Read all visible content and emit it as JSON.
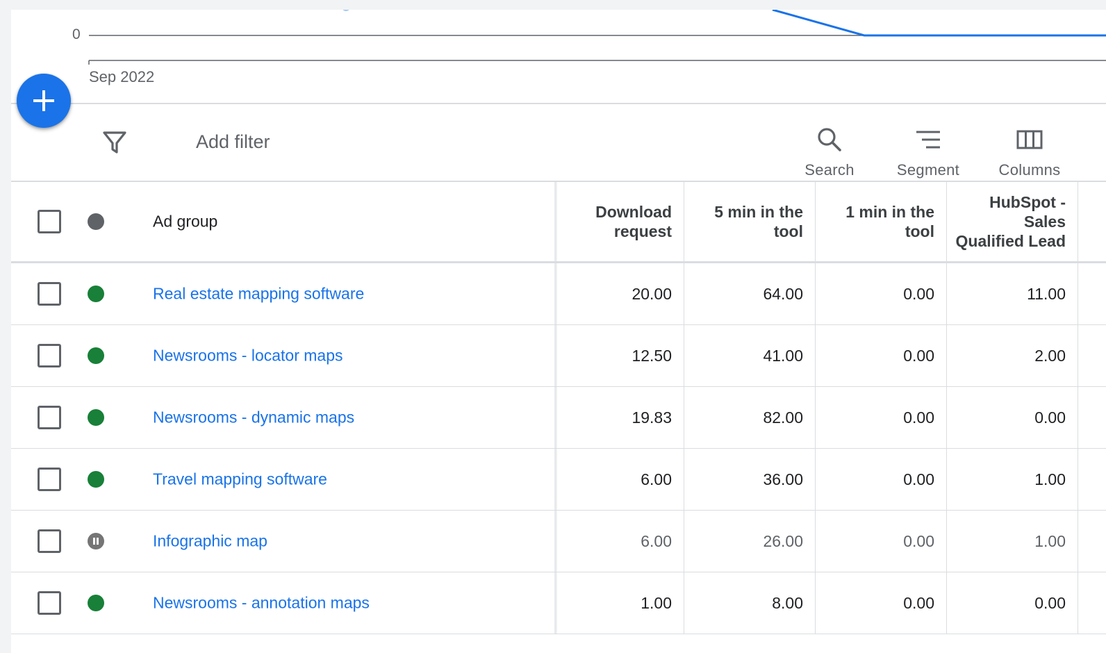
{
  "chart": {
    "y_zero_label": "0",
    "x_start_label": "Sep 2022",
    "line_color": "#1a73e8"
  },
  "fab": {
    "icon": "plus-icon",
    "color": "#1a73e8"
  },
  "toolbar": {
    "filter_icon": "filter-funnel-icon",
    "add_filter_label": "Add filter",
    "search_label": "Search",
    "segment_label": "Segment",
    "columns_label": "Columns"
  },
  "table": {
    "headers": {
      "ad_group": "Ad group",
      "download_request_line1": "Download",
      "download_request_line2": "request",
      "five_min_line1": "5 min in the",
      "five_min_line2": "tool",
      "one_min_line1": "1 min in the",
      "one_min_line2": "tool",
      "hubspot_line1": "HubSpot -",
      "hubspot_line2": "Sales",
      "hubspot_line3": "Qualified Lead"
    },
    "rows": [
      {
        "name": "Real estate mapping software",
        "status": "enabled",
        "download": "20.00",
        "five_min": "64.00",
        "one_min": "0.00",
        "hubspot": "11.00"
      },
      {
        "name": "Newsrooms - locator maps",
        "status": "enabled",
        "download": "12.50",
        "five_min": "41.00",
        "one_min": "0.00",
        "hubspot": "2.00"
      },
      {
        "name": "Newsrooms - dynamic maps",
        "status": "enabled",
        "download": "19.83",
        "five_min": "82.00",
        "one_min": "0.00",
        "hubspot": "0.00"
      },
      {
        "name": "Travel mapping software",
        "status": "enabled",
        "download": "6.00",
        "five_min": "36.00",
        "one_min": "0.00",
        "hubspot": "1.00"
      },
      {
        "name": "Infographic map",
        "status": "paused",
        "download": "6.00",
        "five_min": "26.00",
        "one_min": "0.00",
        "hubspot": "1.00"
      },
      {
        "name": "Newsrooms - annotation maps",
        "status": "enabled",
        "download": "1.00",
        "five_min": "8.00",
        "one_min": "0.00",
        "hubspot": "0.00"
      }
    ]
  },
  "colors": {
    "link": "#1a73e8",
    "enabled": "#188038",
    "paused": "#757575"
  }
}
